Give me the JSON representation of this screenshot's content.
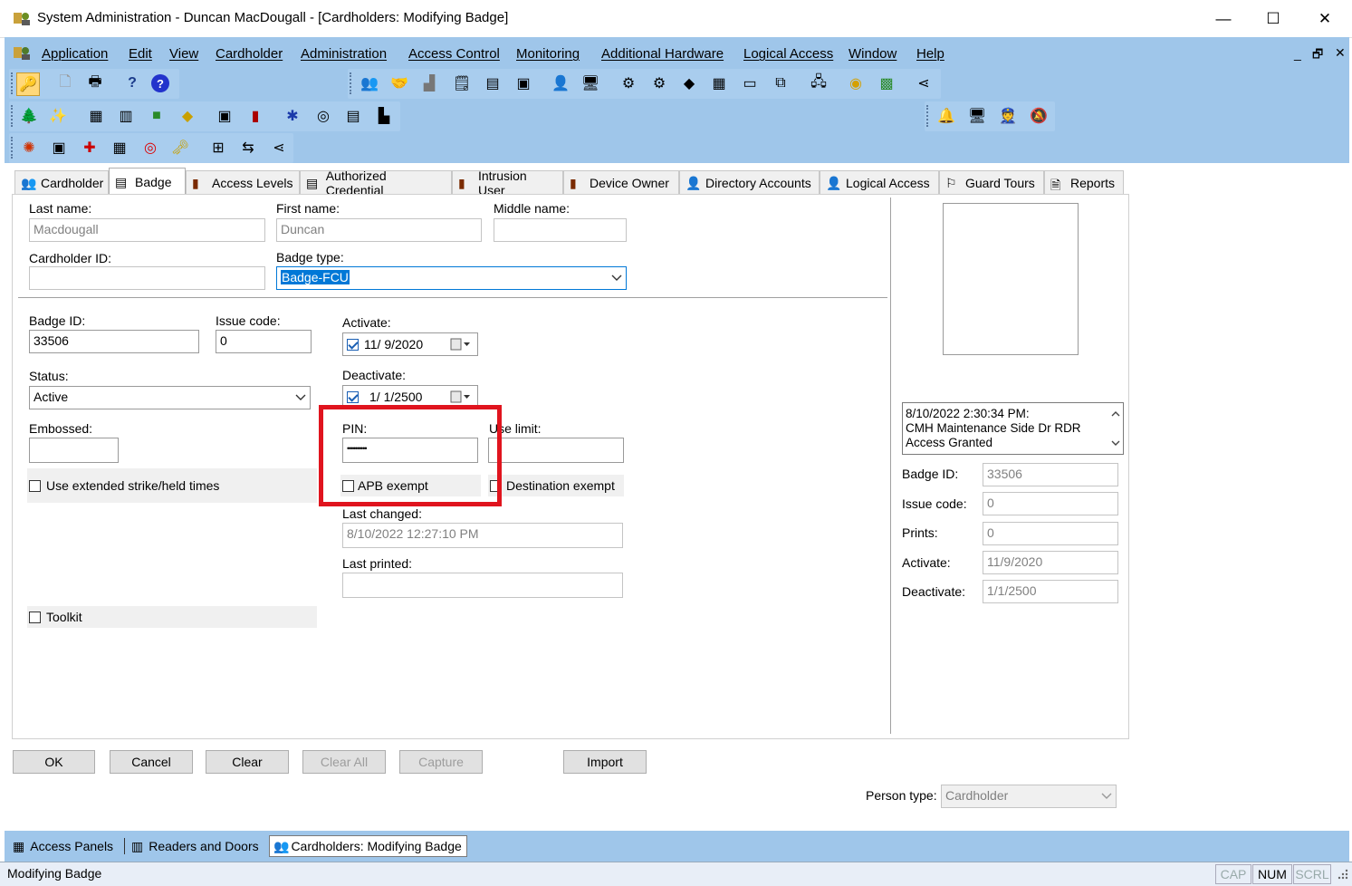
{
  "window": {
    "title": "System Administration - Duncan MacDougall - [Cardholders: Modifying Badge]",
    "min": "—",
    "max": "☐",
    "close": "✕"
  },
  "menu": [
    "Application",
    "Edit",
    "View",
    "Cardholder",
    "Administration",
    "Access Control",
    "Monitoring",
    "Additional Hardware",
    "Logical Access",
    "Window",
    "Help"
  ],
  "mdi_controls": [
    "_",
    "🗗",
    "✕"
  ],
  "tabs": [
    {
      "label": "Cardholder",
      "icon": "cardholder-icon"
    },
    {
      "label": "Badge",
      "icon": "badge-icon"
    },
    {
      "label": "Access Levels",
      "icon": "access-levels-icon"
    },
    {
      "label": "Authorized Credential",
      "icon": "credential-icon"
    },
    {
      "label": "Intrusion User",
      "icon": "intrusion-icon"
    },
    {
      "label": "Device Owner",
      "icon": "device-owner-icon"
    },
    {
      "label": "Directory Accounts",
      "icon": "directory-icon"
    },
    {
      "label": "Logical Access",
      "icon": "logical-access-icon"
    },
    {
      "label": "Guard Tours",
      "icon": "guard-tours-icon"
    },
    {
      "label": "Reports",
      "icon": "reports-icon"
    }
  ],
  "form": {
    "last_name_label": "Last name:",
    "last_name": "Macdougall",
    "first_name_label": "First name:",
    "first_name": "Duncan",
    "middle_name_label": "Middle name:",
    "middle_name": "",
    "cardholder_id_label": "Cardholder ID:",
    "cardholder_id": "",
    "badge_type_label": "Badge type:",
    "badge_type": "Badge-FCU",
    "badge_id_label": "Badge ID:",
    "badge_id": "33506",
    "issue_code_label": "Issue code:",
    "issue_code": "0",
    "activate_label": "Activate:",
    "activate": "11/ 9/2020",
    "deactivate_label": "Deactivate:",
    "deactivate": "1/ 1/2500",
    "status_label": "Status:",
    "status": "Active",
    "embossed_label": "Embossed:",
    "embossed": "",
    "pin_label": "PIN:",
    "pin": "••••••••••",
    "use_limit_label": "Use limit:",
    "use_limit": "",
    "extended_label": "Use extended strike/held times",
    "apb_label": "APB exempt",
    "destination_label": "Destination exempt",
    "last_changed_label": "Last changed:",
    "last_changed": "8/10/2022 12:27:10 PM",
    "last_printed_label": "Last printed:",
    "last_printed": "",
    "toolkit_label": "Toolkit"
  },
  "side": {
    "event_line1": "8/10/2022 2:30:34 PM:",
    "event_line2": "CMH Maintenance Side Dr RDR",
    "event_line3": "Access Granted",
    "badge_id_label": "Badge ID:",
    "badge_id": "33506",
    "issue_code_label": "Issue code:",
    "issue_code": "0",
    "prints_label": "Prints:",
    "prints": "0",
    "activate_label": "Activate:",
    "activate": "11/9/2020",
    "deactivate_label": "Deactivate:",
    "deactivate": "1/1/2500"
  },
  "buttons": {
    "ok": "OK",
    "cancel": "Cancel",
    "clear": "Clear",
    "clear_all": "Clear All",
    "capture": "Capture",
    "import": "Import"
  },
  "person_type_label": "Person type:",
  "person_type": "Cardholder",
  "tasks": [
    "Access Panels",
    "Readers and Doors",
    "Cardholders: Modifying Badge"
  ],
  "status": {
    "text": "Modifying Badge",
    "cap": "CAP",
    "num": "NUM",
    "scrl": "SCRL"
  },
  "colors": {
    "frame": "#9fc6ea",
    "highlight": "#e0141e",
    "selection": "#0078d7"
  }
}
